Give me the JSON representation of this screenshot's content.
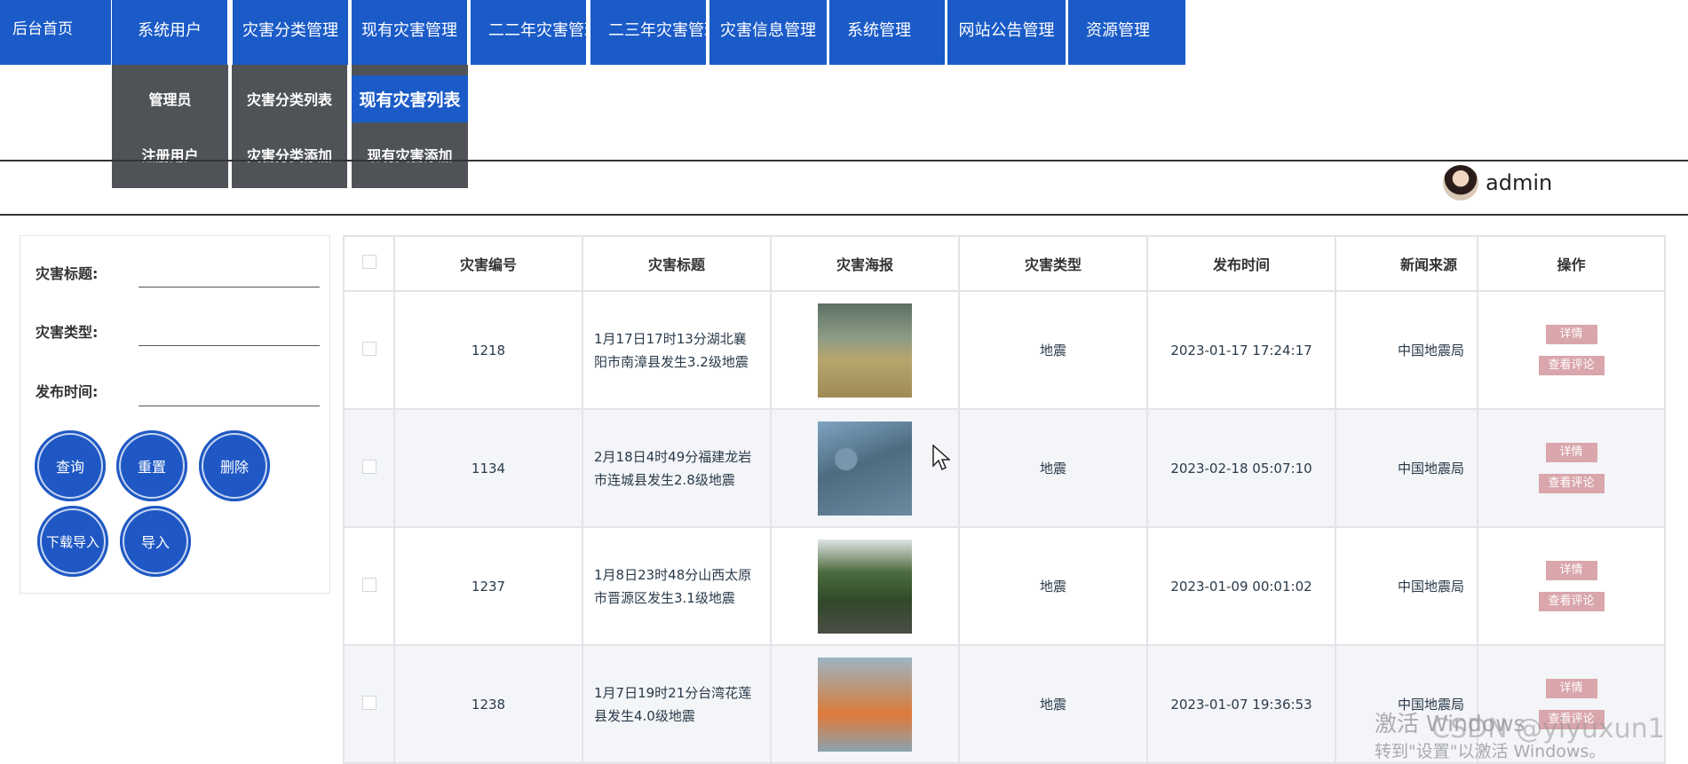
{
  "nav": {
    "items": [
      {
        "label": "后台首页"
      },
      {
        "label": "系统用户"
      },
      {
        "label": "灾害分类管理"
      },
      {
        "label": "现有灾害管理"
      },
      {
        "label": "二二年灾害管理"
      },
      {
        "label": "二三年灾害管理"
      },
      {
        "label": "灾害信息管理"
      },
      {
        "label": "系统管理"
      },
      {
        "label": "网站公告管理"
      },
      {
        "label": "资源管理"
      }
    ],
    "submenus": {
      "system_user": [
        "管理员",
        "注册用户"
      ],
      "category": [
        "灾害分类列表",
        "灾害分类添加"
      ],
      "current": [
        "现有灾害列表",
        "现有灾害添加"
      ]
    }
  },
  "user": {
    "name": "admin"
  },
  "filter": {
    "title_label": "灾害标题:",
    "type_label": "灾害类型:",
    "time_label": "发布时间:",
    "buttons": {
      "query": "查询",
      "reset": "重置",
      "delete": "删除",
      "download": "下载导入",
      "import": "导入"
    }
  },
  "table": {
    "headers": [
      "灾害编号",
      "灾害标题",
      "灾害海报",
      "灾害类型",
      "发布时间",
      "新闻来源",
      "操作"
    ],
    "rows": [
      {
        "id": "1218",
        "title": "1月17日17时13分湖北襄阳市南漳县发生3.2级地震",
        "type": "地震",
        "time": "2023-01-17 17:24:17",
        "source": "中国地震局"
      },
      {
        "id": "1134",
        "title": "2月18日4时49分福建龙岩市连城县发生2.8级地震",
        "type": "地震",
        "time": "2023-02-18 05:07:10",
        "source": "中国地震局"
      },
      {
        "id": "1237",
        "title": "1月8日23时48分山西太原市晋源区发生3.1级地震",
        "type": "地震",
        "time": "2023-01-09 00:01:02",
        "source": "中国地震局"
      },
      {
        "id": "1238",
        "title": "1月7日19时21分台湾花莲县发生4.0级地震",
        "type": "地震",
        "time": "2023-01-07 19:36:53",
        "source": "中国地震局"
      }
    ],
    "ops": {
      "detail": "详情",
      "comments": "查看评论"
    }
  },
  "watermark": {
    "line1": "激活 Windows",
    "line2": "转到\"设置\"以激活 Windows。",
    "csdn": "CSDN @yiyuxun1"
  }
}
